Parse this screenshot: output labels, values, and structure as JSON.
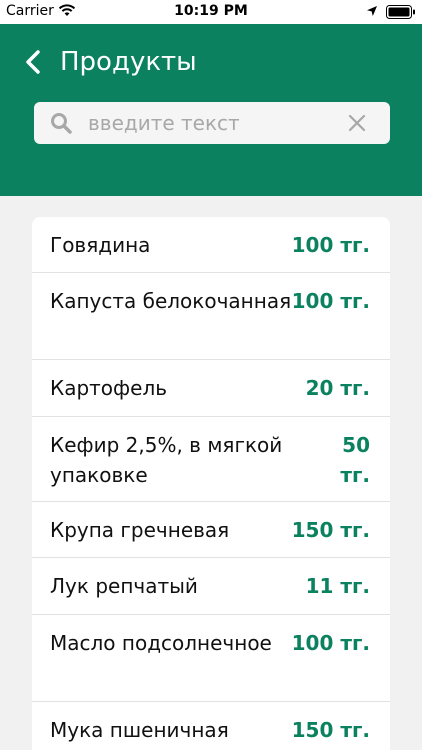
{
  "status_bar": {
    "carrier": "Carrier",
    "time": "10:19 PM",
    "icons": [
      "wifi-icon",
      "location-icon",
      "battery-icon"
    ]
  },
  "header": {
    "title": "Продукты",
    "back_icon": "chevron-left-icon"
  },
  "search": {
    "placeholder": "введите текст",
    "value": "",
    "icon": "search-icon",
    "clear_icon": "close-icon"
  },
  "products": [
    {
      "name": "Говядина",
      "price": "100 тг."
    },
    {
      "name": "Капуста белокочанная",
      "price": "100 тг."
    },
    {
      "name": "Картофель",
      "price": "20 тг."
    },
    {
      "name": "Кефир 2,5%, в мягкой упаковке",
      "price": "50 тг."
    },
    {
      "name": "Крупа гречневая",
      "price": "150 тг."
    },
    {
      "name": "Лук репчатый",
      "price": "11 тг."
    },
    {
      "name": "Масло подсолнечное",
      "price": "100 тг."
    },
    {
      "name": "Мука пшеничная",
      "price": "150 тг."
    }
  ],
  "colors": {
    "accent": "#0b8160",
    "background": "#f1f1f1",
    "card": "#ffffff"
  }
}
